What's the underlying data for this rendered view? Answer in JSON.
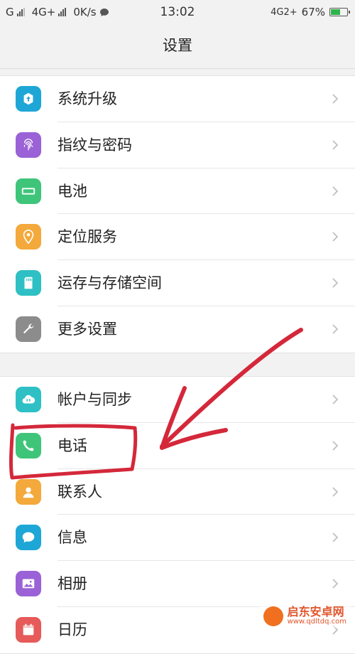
{
  "status_bar": {
    "sim1": "G",
    "sim2": "4G+",
    "speed": "0K/s",
    "time": "13:02",
    "network": "4G2+",
    "battery": "67%",
    "battery_level": 0.67
  },
  "header": {
    "title": "设置"
  },
  "groups": [
    {
      "items": [
        {
          "label": "系统升级",
          "icon": "system-update-icon",
          "color": "#1ea7d6"
        },
        {
          "label": "指纹与密码",
          "icon": "fingerprint-icon",
          "color": "#9a62d6"
        },
        {
          "label": "电池",
          "icon": "battery-icon",
          "color": "#3fc57a"
        },
        {
          "label": "定位服务",
          "icon": "location-pin-icon",
          "color": "#f3a93b"
        },
        {
          "label": "运存与存储空间",
          "icon": "sd-card-icon",
          "color": "#2ec0c4"
        },
        {
          "label": "更多设置",
          "icon": "wrench-icon",
          "color": "#8c8c8c"
        }
      ]
    },
    {
      "items": [
        {
          "label": "帐户与同步",
          "icon": "cloud-sync-icon",
          "color": "#2ec0c4"
        },
        {
          "label": "电话",
          "icon": "phone-icon",
          "color": "#3fc57a"
        },
        {
          "label": "联系人",
          "icon": "contacts-icon",
          "color": "#f3a93b"
        },
        {
          "label": "信息",
          "icon": "message-icon",
          "color": "#1ea7d6"
        },
        {
          "label": "相册",
          "icon": "album-icon",
          "color": "#9a62d6"
        },
        {
          "label": "日历",
          "icon": "calendar-icon",
          "color": "#e65a5a"
        }
      ]
    }
  ],
  "annotation_color": "#d4283a",
  "watermark": {
    "main": "启东安卓网",
    "sub": "www.qdltdq.com"
  }
}
